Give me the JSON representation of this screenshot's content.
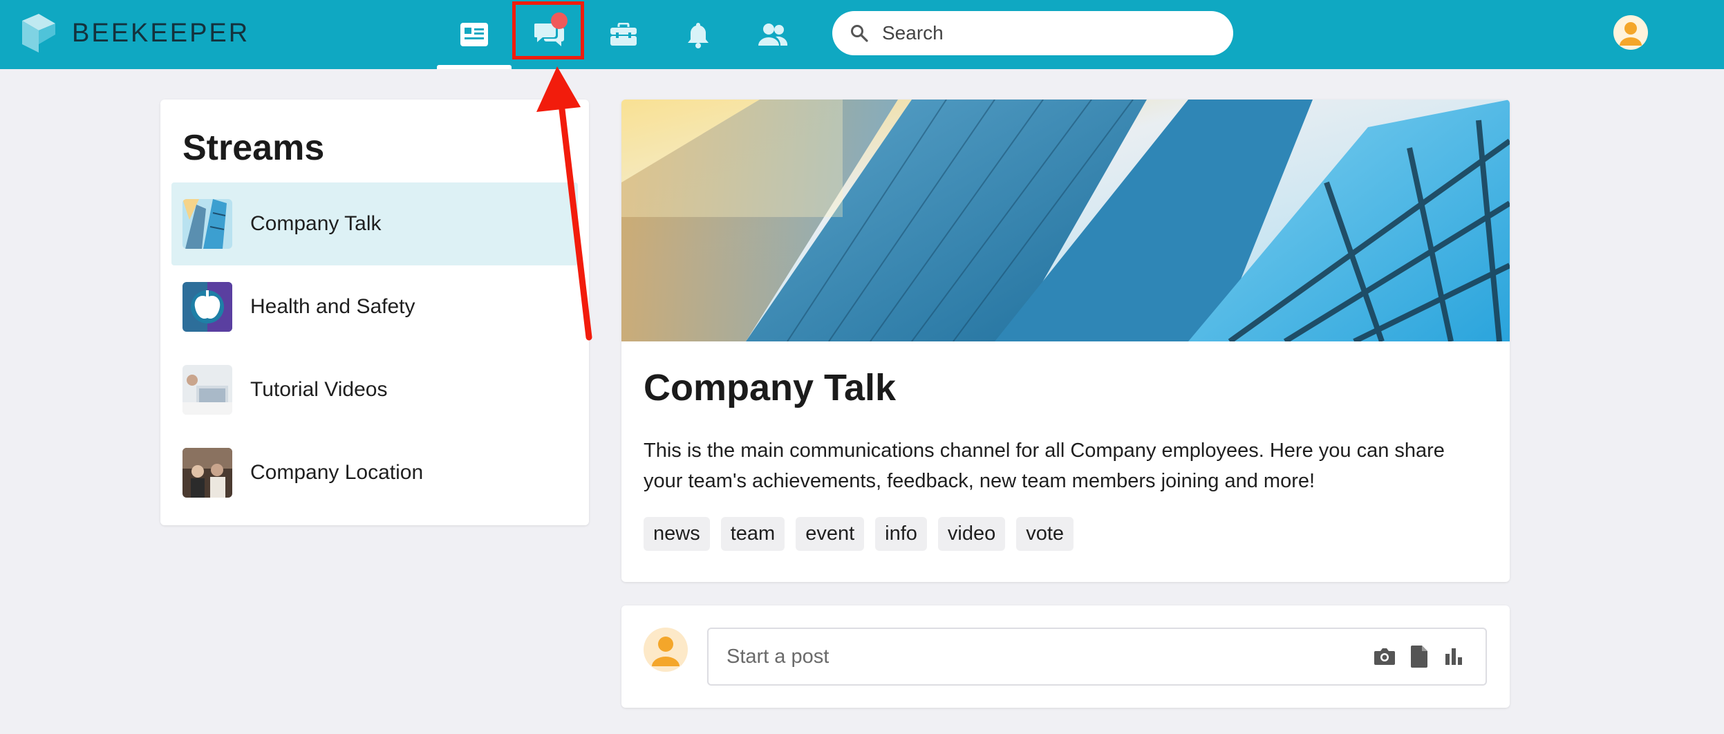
{
  "app": {
    "name": "BEEKEEPER"
  },
  "nav": {
    "items": [
      {
        "name": "home-feed",
        "icon": "feed-icon",
        "active": true
      },
      {
        "name": "chats",
        "icon": "chat-icon",
        "notification": true
      },
      {
        "name": "tools",
        "icon": "toolbox-icon"
      },
      {
        "name": "notifications",
        "icon": "bell-icon"
      },
      {
        "name": "people",
        "icon": "people-icon"
      }
    ],
    "search_placeholder": "Search"
  },
  "streams": {
    "title": "Streams",
    "items": [
      {
        "label": "Company Talk",
        "active": true
      },
      {
        "label": "Health and Safety"
      },
      {
        "label": "Tutorial Videos"
      },
      {
        "label": "Company Location"
      }
    ]
  },
  "stream_detail": {
    "title": "Company Talk",
    "description": "This is the main communications channel for all Company employees. Here you can share your team's achievements, feedback, new team members joining and more!",
    "tags": [
      "news",
      "team",
      "event",
      "info",
      "video",
      "vote"
    ]
  },
  "composer": {
    "placeholder": "Start a post",
    "actions": [
      "camera-icon",
      "document-icon",
      "poll-icon"
    ]
  },
  "colors": {
    "brand": "#0fa8c2",
    "highlight": "#f21c0c",
    "notification": "#f05a5a",
    "active_stream_bg": "#ddf1f5"
  }
}
